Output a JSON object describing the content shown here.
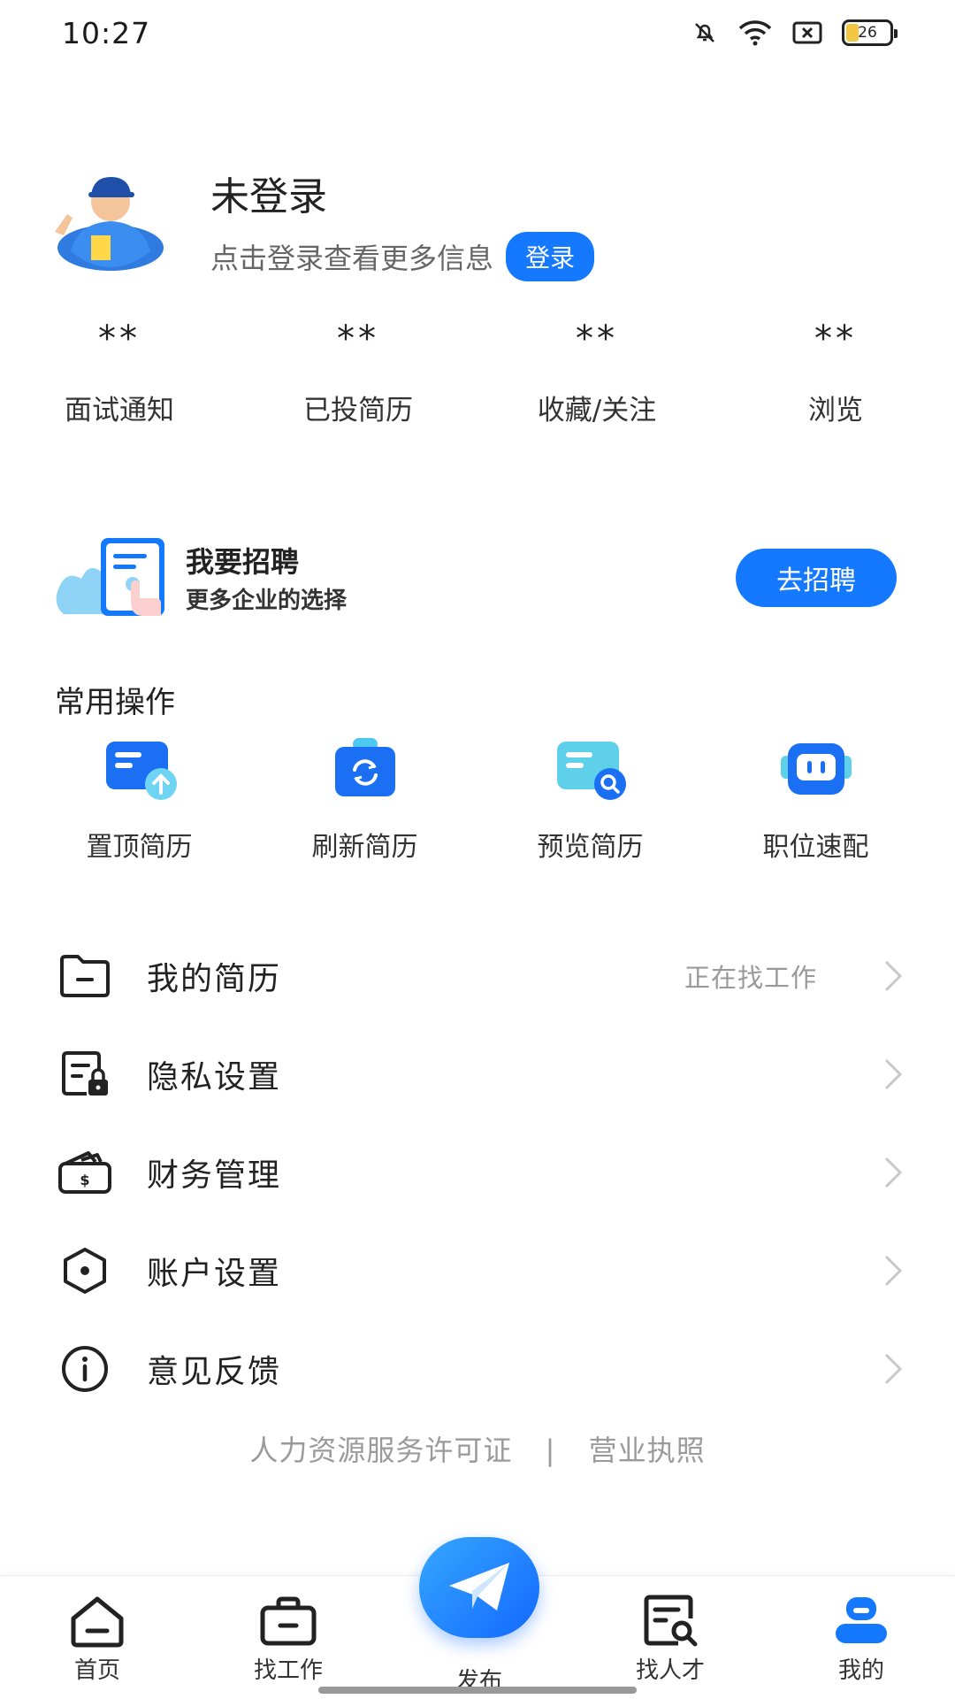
{
  "status_bar": {
    "time": "10:27",
    "battery": "26",
    "icons": [
      "mute-bell-icon",
      "wifi-icon",
      "sim-x-icon",
      "battery-icon"
    ]
  },
  "profile": {
    "name": "未登录",
    "subtitle": "点击登录查看更多信息",
    "login_label": "登录"
  },
  "stats": [
    {
      "value": "**",
      "label": "面试通知"
    },
    {
      "value": "**",
      "label": "已投简历"
    },
    {
      "value": "**",
      "label": "收藏/关注"
    },
    {
      "value": "**",
      "label": "浏览"
    }
  ],
  "recruit": {
    "title": "我要招聘",
    "subtitle": "更多企业的选择",
    "button": "去招聘"
  },
  "common_ops": {
    "title": "常用操作",
    "items": [
      {
        "label": "置顶简历",
        "icon": "pin-resume-icon"
      },
      {
        "label": "刷新简历",
        "icon": "refresh-resume-icon"
      },
      {
        "label": "预览简历",
        "icon": "preview-resume-icon"
      },
      {
        "label": "职位速配",
        "icon": "job-match-icon"
      }
    ]
  },
  "menu": [
    {
      "label": "我的简历",
      "status": "正在找工作",
      "icon": "folder-icon"
    },
    {
      "label": "隐私设置",
      "status": "",
      "icon": "privacy-lock-icon"
    },
    {
      "label": "财务管理",
      "status": "",
      "icon": "wallet-icon"
    },
    {
      "label": "账户设置",
      "status": "",
      "icon": "hexagon-settings-icon"
    },
    {
      "label": "意见反馈",
      "status": "",
      "icon": "info-icon"
    }
  ],
  "footer": {
    "license": "人力资源服务许可证",
    "separator": "|",
    "business": "营业执照"
  },
  "bottom_nav": {
    "items": [
      {
        "label": "首页",
        "icon": "home-icon"
      },
      {
        "label": "找工作",
        "icon": "briefcase-icon"
      },
      {
        "label": "发布",
        "icon": "paper-plane-icon"
      },
      {
        "label": "找人才",
        "icon": "talent-search-icon"
      },
      {
        "label": "我的",
        "icon": "profile-icon"
      }
    ],
    "active": "我的"
  },
  "colors": {
    "accent": "#1479ff",
    "muted_text": "#999999",
    "background": "#ffffff"
  }
}
